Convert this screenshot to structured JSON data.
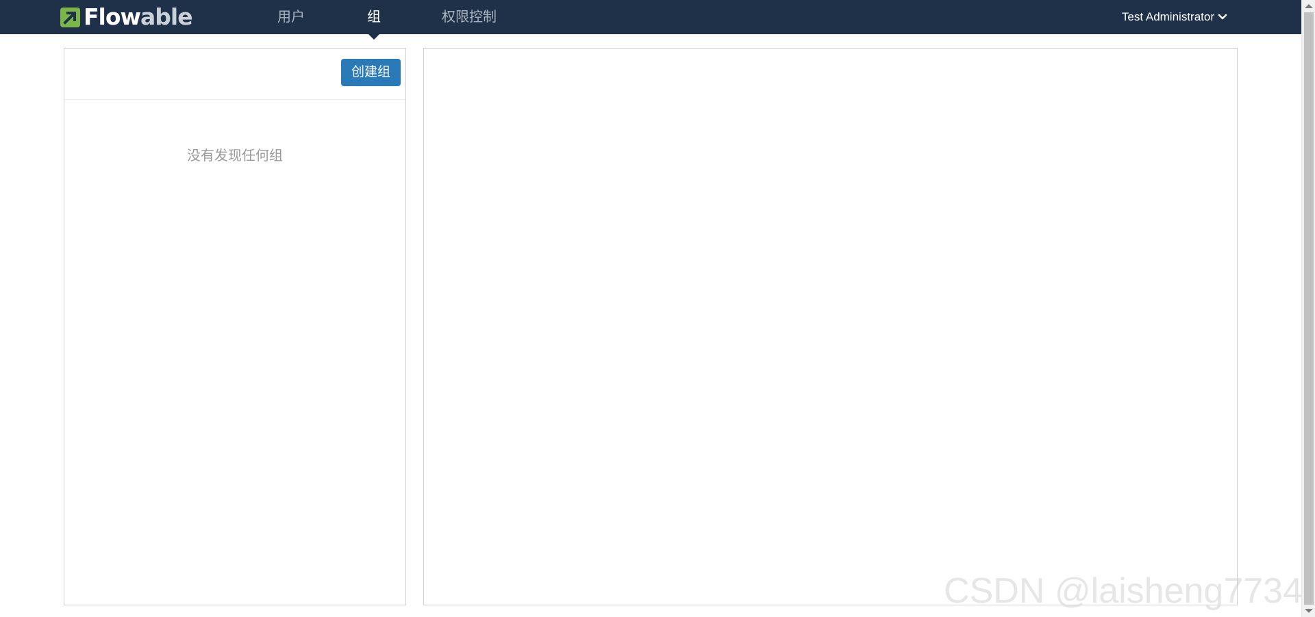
{
  "app": {
    "brand": {
      "part1": "Flow",
      "part2": "able",
      "icon": "flowable-logo-icon",
      "accent": "#7ab648"
    }
  },
  "nav": {
    "items": [
      {
        "label": "用户",
        "active": false
      },
      {
        "label": "组",
        "active": true
      },
      {
        "label": "权限控制",
        "active": false
      }
    ]
  },
  "user": {
    "name": "Test Administrator",
    "icon": "chevron-down-icon"
  },
  "groups_panel": {
    "create_button_label": "创建组",
    "empty_message": "没有发现任何组"
  },
  "watermark": "CSDN @laisheng7734",
  "colors": {
    "topbar": "#1f3149",
    "primary_button": "#2a7ab8",
    "nav_inactive": "#a9b3be",
    "nav_active": "#ffffff"
  }
}
